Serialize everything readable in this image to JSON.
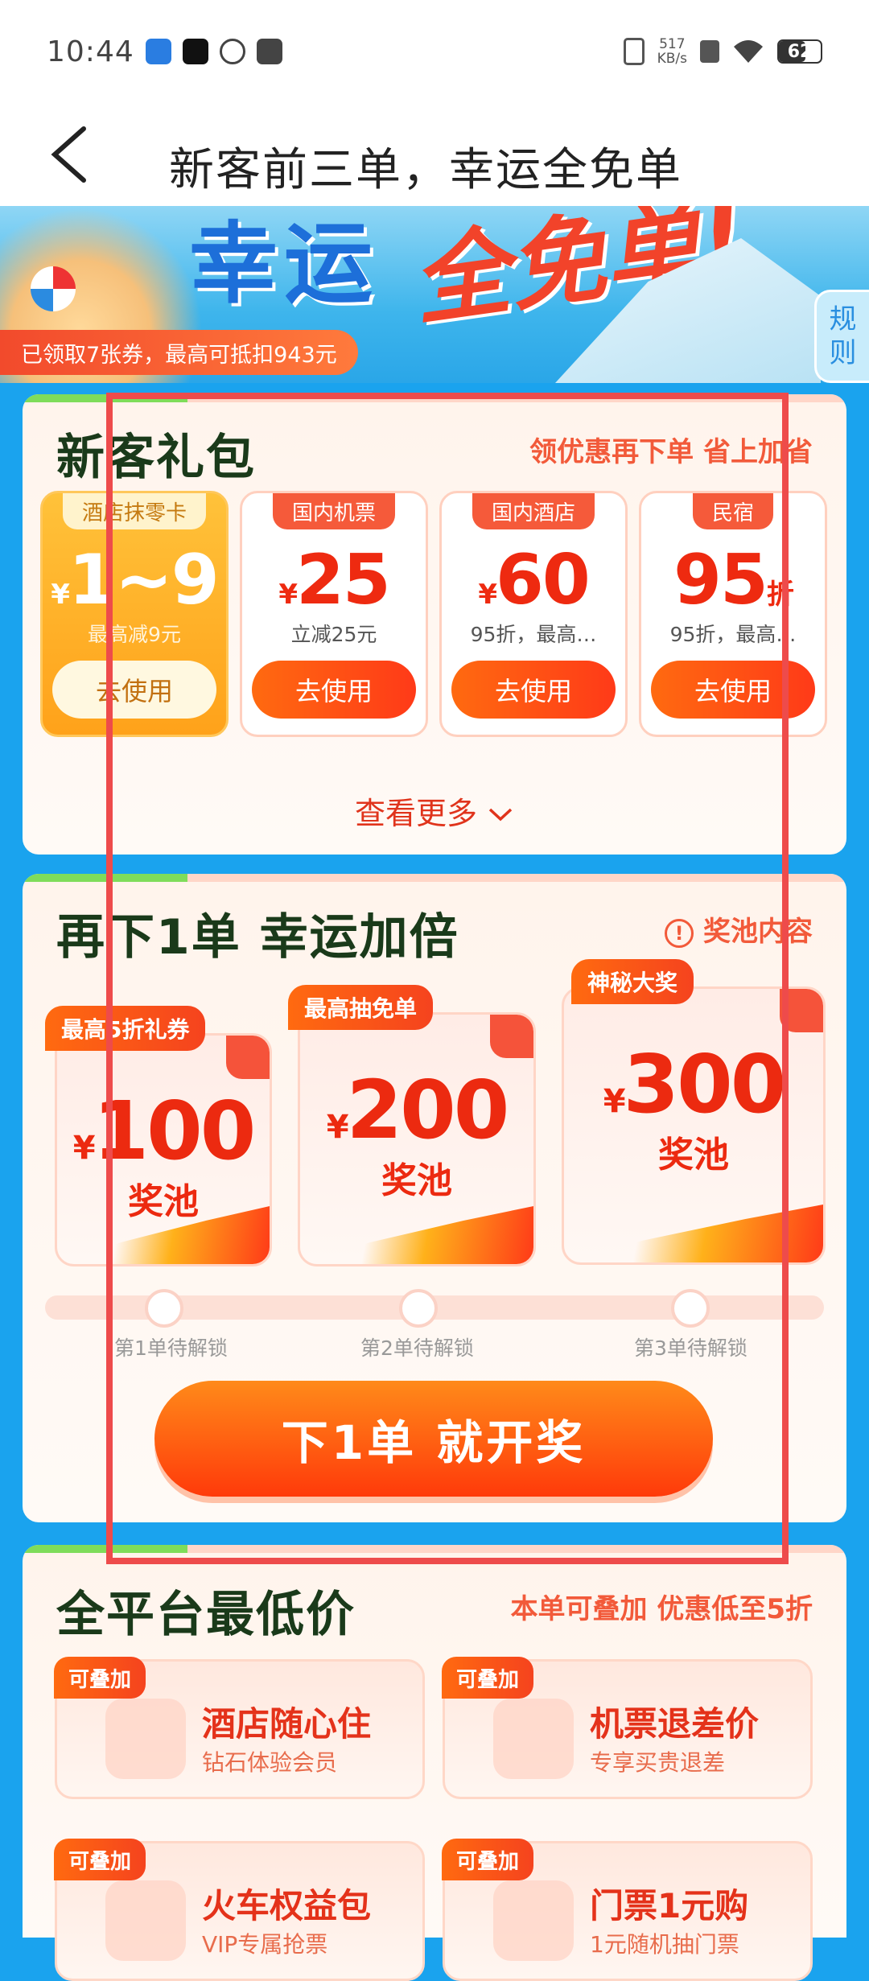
{
  "status": {
    "time": "10:44",
    "speed_top": "517",
    "speed_bottom": "KB/s",
    "battery": "62"
  },
  "header": {
    "title": "新客前三单，幸运全免单"
  },
  "banner": {
    "headline": "幸运",
    "headline_script": "全免单!",
    "coupon_text": "已领取7张券，最高可抵扣943元",
    "rules_top": "规",
    "rules_bottom": "则"
  },
  "new_gift": {
    "title": "新客礼包",
    "subtitle": "领优惠再下单 省上加省",
    "items": [
      {
        "tag": "酒店抹零卡",
        "currency": "¥",
        "amount": "1~9",
        "unit": "",
        "desc": "最高减9元",
        "button": "去使用"
      },
      {
        "tag": "国内机票",
        "currency": "¥",
        "amount": "25",
        "unit": "",
        "desc": "立减25元",
        "button": "去使用"
      },
      {
        "tag": "国内酒店",
        "currency": "¥",
        "amount": "60",
        "unit": "",
        "desc": "95折，最高…",
        "button": "去使用"
      },
      {
        "tag": "民宿",
        "currency": "",
        "amount": "95",
        "unit": "折",
        "desc": "95折，最高…",
        "button": "去使用"
      }
    ],
    "view_more": "查看更多"
  },
  "lucky": {
    "title": "再下1单 幸运加倍",
    "pool_link": "奖池内容",
    "pools": [
      {
        "tag": "最高5折礼券",
        "currency": "¥",
        "amount": "100",
        "label": "奖池",
        "progress": "第1单待解锁"
      },
      {
        "tag": "最高抽免单",
        "currency": "¥",
        "amount": "200",
        "label": "奖池",
        "progress": "第2单待解锁"
      },
      {
        "tag": "神秘大奖",
        "currency": "¥",
        "amount": "300",
        "label": "奖池",
        "progress": "第3单待解锁"
      }
    ],
    "cta": "下1单 就开奖"
  },
  "lowest": {
    "title": "全平台最低价",
    "subtitle": "本单可叠加 优惠低至5折",
    "features": [
      {
        "tag": "可叠加",
        "title": "酒店随心住",
        "sub": "钻石体验会员"
      },
      {
        "tag": "可叠加",
        "title": "机票退差价",
        "sub": "专享买贵退差"
      },
      {
        "tag": "可叠加",
        "title": "火车权益包",
        "sub": "VIP专属抢票"
      },
      {
        "tag": "可叠加",
        "title": "门票1元购",
        "sub": "1元随机抽门票"
      }
    ]
  },
  "colors": {
    "accent": "#ff4a18",
    "page_bg": "#1aa3ee"
  }
}
